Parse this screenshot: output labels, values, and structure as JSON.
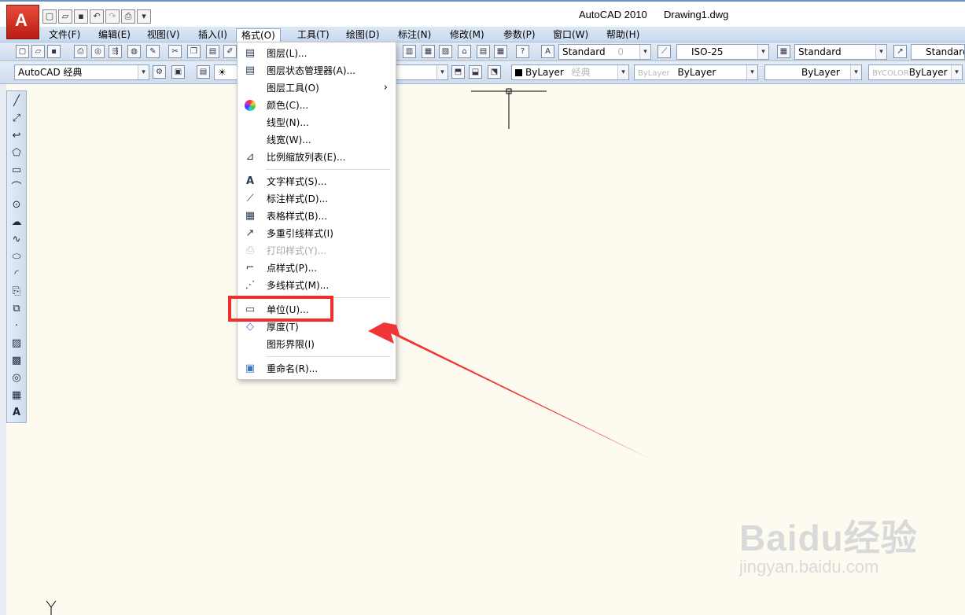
{
  "title": {
    "app": "AutoCAD 2010",
    "document": "Drawing1.dwg"
  },
  "menubar": [
    {
      "label": "文件(F)",
      "name": "menu-file"
    },
    {
      "label": "编辑(E)",
      "name": "menu-edit"
    },
    {
      "label": "视图(V)",
      "name": "menu-view"
    },
    {
      "label": "插入(I)",
      "name": "menu-insert"
    },
    {
      "label": "格式(O)",
      "name": "menu-format"
    },
    {
      "label": "工具(T)",
      "name": "menu-tools"
    },
    {
      "label": "绘图(D)",
      "name": "menu-draw"
    },
    {
      "label": "标注(N)",
      "name": "menu-dimension"
    },
    {
      "label": "修改(M)",
      "name": "menu-modify"
    },
    {
      "label": "参数(P)",
      "name": "menu-parametric"
    },
    {
      "label": "窗口(W)",
      "name": "menu-window"
    },
    {
      "label": "帮助(H)",
      "name": "menu-help"
    }
  ],
  "toolbar": {
    "workspace": "AutoCAD 经典",
    "text_style": "Standard",
    "dim_style": "ISO-25",
    "table_style": "Standard",
    "mleader_style": "Standard",
    "color": "ByLayer",
    "linetype": "ByLayer",
    "lineweight": "ByLayer",
    "plotstyle": "ByLayer",
    "ghost_0": "0",
    "ghost_classic": "经典",
    "ghost_bylayer": "ByLayer",
    "ghost_bycolor": "BYCOLOR"
  },
  "format_menu": {
    "items": [
      {
        "label": "图层(L)...",
        "icon": "layers-icon",
        "glyph": "▤",
        "name": "menu-item-layer"
      },
      {
        "label": "图层状态管理器(A)...",
        "icon": "layer-state-icon",
        "glyph": "▤",
        "name": "menu-item-layer-state"
      },
      {
        "label": "图层工具(O)",
        "icon": "",
        "glyph": "",
        "name": "menu-item-layer-tools",
        "submenu": "›"
      },
      {
        "label": "颜色(C)...",
        "icon": "color-wheel-icon",
        "glyph": "●",
        "name": "menu-item-color"
      },
      {
        "label": "线型(N)...",
        "icon": "",
        "glyph": "",
        "name": "menu-item-linetype"
      },
      {
        "label": "线宽(W)...",
        "icon": "",
        "glyph": "",
        "name": "menu-item-lineweight"
      },
      {
        "label": "比例缩放列表(E)...",
        "icon": "scale-list-icon",
        "glyph": "⊿",
        "name": "menu-item-scale-list"
      },
      {
        "label": "文字样式(S)...",
        "icon": "text-style-icon",
        "glyph": "A",
        "name": "menu-item-text-style"
      },
      {
        "label": "标注样式(D)...",
        "icon": "dim-style-icon",
        "glyph": "⟋",
        "name": "menu-item-dim-style"
      },
      {
        "label": "表格样式(B)...",
        "icon": "table-style-icon",
        "glyph": "▦",
        "name": "menu-item-table-style"
      },
      {
        "label": "多重引线样式(I)",
        "icon": "mleader-style-icon",
        "glyph": "↗",
        "name": "menu-item-mleader-style"
      },
      {
        "label": "打印样式(Y)...",
        "icon": "plot-style-icon",
        "glyph": "⎙",
        "name": "menu-item-plot-style",
        "disabled": true
      },
      {
        "label": "点样式(P)...",
        "icon": "point-style-icon",
        "glyph": "⌐",
        "name": "menu-item-point-style"
      },
      {
        "label": "多线样式(M)...",
        "icon": "mline-style-icon",
        "glyph": "⋰",
        "name": "menu-item-mline-style"
      },
      {
        "label": "单位(U)...",
        "icon": "units-icon",
        "glyph": "▭",
        "name": "menu-item-units"
      },
      {
        "label": "厚度(T)",
        "icon": "thickness-icon",
        "glyph": "◇",
        "name": "menu-item-thickness"
      },
      {
        "label": "图形界限(I)",
        "icon": "",
        "glyph": "",
        "name": "menu-item-drawing-limits"
      },
      {
        "label": "重命名(R)...",
        "icon": "rename-icon",
        "glyph": "▣",
        "name": "menu-item-rename"
      }
    ]
  },
  "annotation": {
    "color": "#ef2e2e"
  },
  "canvas": {
    "ucs_label": "Y"
  },
  "watermark": {
    "brand": "Baidu经验",
    "url": "jingyan.baidu.com"
  }
}
